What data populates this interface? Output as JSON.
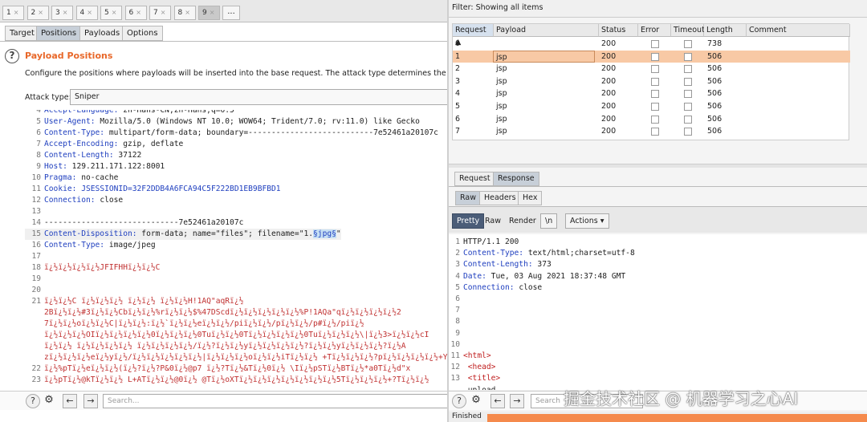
{
  "numbered_tabs": [
    {
      "label": "1",
      "close": "×"
    },
    {
      "label": "2",
      "close": "×"
    },
    {
      "label": "3",
      "close": "×"
    },
    {
      "label": "4",
      "close": "×"
    },
    {
      "label": "5",
      "close": "×"
    },
    {
      "label": "6",
      "close": "×"
    },
    {
      "label": "7",
      "close": "×"
    },
    {
      "label": "8",
      "close": "×"
    },
    {
      "label": "9",
      "close": "×"
    }
  ],
  "more_tabs": "...",
  "intruder_tabs": [
    "Target",
    "Positions",
    "Payloads",
    "Options"
  ],
  "payload_positions": {
    "title": "Payload Positions",
    "description": "Configure the positions where payloads will be inserted into the base request. The attack type determines the way in which",
    "attack_type_label": "Attack type:",
    "attack_type_value": "Sniper"
  },
  "request_lines": [
    {
      "n": "4",
      "key": "Accept-Language:",
      "val": " zh-Hans-CN,zh-Hans;q=0.5"
    },
    {
      "n": "5",
      "key": "User-Agent:",
      "val": " Mozilla/5.0 (Windows NT 10.0; WOW64; Trident/7.0; rv:11.0) like Gecko"
    },
    {
      "n": "6",
      "key": "Content-Type:",
      "val": " multipart/form-data; boundary=---------------------------7e52461a20107c"
    },
    {
      "n": "7",
      "key": "Accept-Encoding:",
      "val": " gzip, deflate"
    },
    {
      "n": "8",
      "key": "Content-Length:",
      "val": " 37122"
    },
    {
      "n": "9",
      "key": "Host:",
      "val": " 129.211.171.122:8001"
    },
    {
      "n": "10",
      "key": "Pragma:",
      "val": " no-cache"
    },
    {
      "n": "11",
      "key": "Cookie:",
      "val": " JSESSIONID=32F2DDB4A6FCA94C5F222BD1EB9BFBD1"
    },
    {
      "n": "12",
      "key": "Connection:",
      "val": " close"
    },
    {
      "n": "13",
      "key": "",
      "val": ""
    },
    {
      "n": "14",
      "key": "",
      "val": "-----------------------------7e52461a20107c"
    },
    {
      "n": "15",
      "key": "Content-Disposition:",
      "val": " form-data; name=\"files\"; filename=\"1.",
      "mark": "§jpg§",
      "tail": "\""
    },
    {
      "n": "16",
      "key": "Content-Type:",
      "val": " image/jpeg"
    },
    {
      "n": "17",
      "key": "",
      "val": ""
    },
    {
      "n": "18",
      "key": "",
      "val": "ï¿½ï¿½ï¿½ï¿½JFIFHHï¿½ï¿½C",
      "garb": true
    },
    {
      "n": "19",
      "key": "",
      "val": ""
    },
    {
      "n": "20",
      "key": "",
      "val": ""
    },
    {
      "n": "21",
      "key": "",
      "val": "ï¿½ï¿½C   ï¿½ï¿½ï¿½ ï¿½ï¿½  ï¿½ï¿½H!1AQ\"aqRï¿½",
      "garb": true
    },
    {
      "n": "",
      "key": "",
      "val": "2Bï¿½ï¿½#3ï¿½ï¿½Cbï¿½ï¿½%rï¿½ï¿½$%47DScdï¿½ï¿½ï¿½ï¿½ï¿½%P!1AQa\"qï¿½ï¿½ï¿½ï¿½2",
      "garb": true
    },
    {
      "n": "",
      "key": "",
      "val": "7ï¿½ï¿½oï¿½ï¿½C|ï¿½ï¿½:ï¿½`ï¿½ï¿½eï¿½ï¿½/piï¿½ï¿½/pï¿½ï¿½/p#ï¿½/piï¿½",
      "garb": true
    },
    {
      "n": "",
      "key": "",
      "val": "ï¿½ï¿½ï¿½OIï¿½ï¿½ï¿½ï¿½0ï¿½ï¿½ï¿½0Tuï¿½ï¿½0Tï¿½ï¿½ï¿½ï¿½0Tuï¿½ï¿½ï¿½\\|ï¿½3>ï¿½ï¿½cI",
      "garb": true
    },
    {
      "n": "",
      "key": "",
      "val": "ï¿½ï¿½ ï¿½ï¿½ï¿½ï¿½ ï¿½ï¿½ï¿½ï¿½/ï¿½?ï¿½ï¿½yï¿½ï¿½ï¿½ï¿½?ï¿½ï¿½yï¿½ï¿½ï¿½?ï¿½A",
      "garb": true
    },
    {
      "n": "",
      "key": "",
      "val": "zï¿½ï¿½ï¿½eï¿½yï¿½/ï¿½ï¿½ï¿½ï¿½ï¿½|ï¿½ï¿½ï¿½oï¿½ï¿½iTï¿½ï¿½ +Tï¿½ï¿½ï¿½?pï¿½ï¿½ï¿½ï¿½+Yaï¿½'",
      "garb": true
    },
    {
      "n": "22",
      "key": "",
      "val": "ï¿½%pTï¿½eï¿½ï¿½(ï¿½?ï¿½?P&0ï¿½@p7  ï¿½?Tï¿½&Tï¿½0ï¿½ \\Iï¿½pSTï¿½BTï¿½*a0Tï¿½d\"x",
      "garb": true
    },
    {
      "n": "23",
      "key": "",
      "val": "ï¿½pTï¿½@kTï¿½ï¿½ L+ATï¿½ï¿½@0ï¿½ @Tï¿½oXTï¿½ï¿½ï¿½ï¿½ï¿½ï¿½ï¿½5Tï¿½ï¿½ï¿½+?Tï¿½ï¿½",
      "garb": true
    }
  ],
  "bottom_bar": {
    "search_placeholder": "Search...",
    "prev": "←",
    "next": "→",
    "help": "?",
    "settings": "⚙"
  },
  "bottom_text": "",
  "results": {
    "filter": "Filter: Showing all items",
    "columns": [
      "Request ▲",
      "Payload",
      "Status",
      "Error",
      "Timeout",
      "Length",
      "Comment"
    ],
    "rows": [
      {
        "request": "0",
        "payload": "",
        "status": "200",
        "length": "738",
        "selected": false
      },
      {
        "request": "1",
        "payload": "jsp",
        "status": "200",
        "length": "506",
        "selected": true
      },
      {
        "request": "2",
        "payload": "jsp",
        "status": "200",
        "length": "506",
        "selected": false
      },
      {
        "request": "3",
        "payload": "jsp",
        "status": "200",
        "length": "506",
        "selected": false
      },
      {
        "request": "4",
        "payload": "jsp",
        "status": "200",
        "length": "506",
        "selected": false
      },
      {
        "request": "5",
        "payload": "jsp",
        "status": "200",
        "length": "506",
        "selected": false
      },
      {
        "request": "6",
        "payload": "jsp",
        "status": "200",
        "length": "506",
        "selected": false
      },
      {
        "request": "7",
        "payload": "jsp",
        "status": "200",
        "length": "506",
        "selected": false
      }
    ]
  },
  "rr_tabs": [
    "Request",
    "Response"
  ],
  "view_tabs": [
    "Raw",
    "Headers",
    "Hex"
  ],
  "pretty_bar": {
    "pretty": "Pretty",
    "raw": "Raw",
    "render": "Render",
    "newline": "\\n",
    "actions": "Actions ▾"
  },
  "response_lines": [
    {
      "n": "1",
      "key": "",
      "val": "HTTP/1.1 200"
    },
    {
      "n": "2",
      "key": "Content-Type:",
      "val": " text/html;charset=utf-8"
    },
    {
      "n": "3",
      "key": "Content-Length:",
      "val": " 373"
    },
    {
      "n": "4",
      "key": "Date:",
      "val": " Tue, 03 Aug 2021 18:37:48 GMT"
    },
    {
      "n": "5",
      "key": "Connection:",
      "val": " close"
    },
    {
      "n": "6",
      "key": "",
      "val": ""
    },
    {
      "n": "7",
      "key": "",
      "val": ""
    },
    {
      "n": "8",
      "key": "",
      "val": ""
    },
    {
      "n": "9",
      "key": "",
      "val": ""
    },
    {
      "n": "10",
      "key": "",
      "val": ""
    },
    {
      "n": "11",
      "key": "",
      "val": "<html>",
      "tag": true
    },
    {
      "n": "12",
      "key": "",
      "val": "  <head>",
      "tag": true
    },
    {
      "n": "13",
      "key": "",
      "val": "    <title>",
      "tag": true
    },
    {
      "n": "",
      "key": "",
      "val": "      upload"
    }
  ],
  "right_bottom": {
    "search_placeholder": "Search",
    "prev": "←",
    "next": "→"
  },
  "status_text": "Finished",
  "progress": 1.0,
  "watermark": "掘金技术社区 @ 机器学习之心AI",
  "colors": {
    "accent": "#e8682a",
    "selected_row": "#f8c9a5",
    "progress": "#f58a4c"
  }
}
